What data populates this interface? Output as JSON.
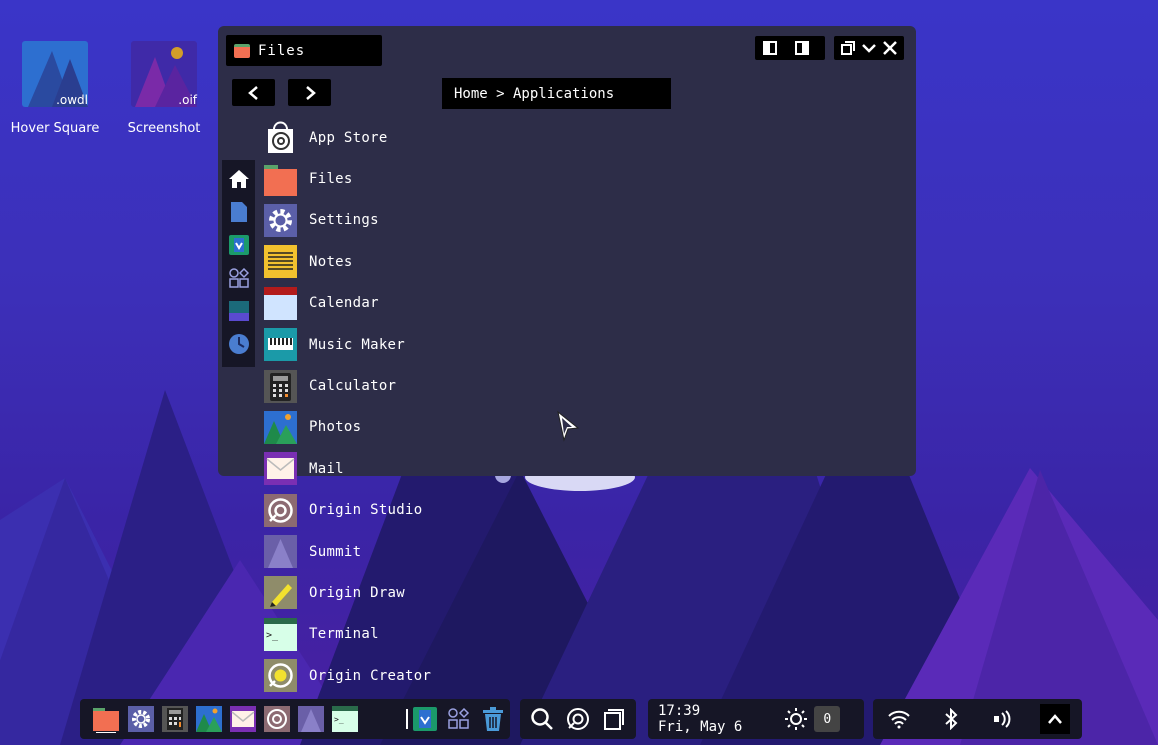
{
  "desktop": {
    "icons": [
      {
        "label": "Hover Square",
        "ext": ".owdl"
      },
      {
        "label": "Screenshot",
        "ext": ".oif"
      }
    ]
  },
  "window": {
    "title": "Files",
    "breadcrumb": "Home > Applications",
    "apps": [
      {
        "name": "App Store",
        "icon": "app-store-icon",
        "color": "#f2f2f2"
      },
      {
        "name": "Files",
        "icon": "folder-icon",
        "color": "#f26f52"
      },
      {
        "name": "Settings",
        "icon": "gear-icon",
        "color": "#5b5fa8"
      },
      {
        "name": "Notes",
        "icon": "notes-icon",
        "color": "#f2c12e"
      },
      {
        "name": "Calendar",
        "icon": "calendar-icon",
        "color": "#d0e4ff"
      },
      {
        "name": "Music Maker",
        "icon": "keyboard-icon",
        "color": "#1b9aa8"
      },
      {
        "name": "Calculator",
        "icon": "calculator-icon",
        "color": "#666666"
      },
      {
        "name": "Photos",
        "icon": "photos-icon",
        "color": "#2d6fd0"
      },
      {
        "name": "Mail",
        "icon": "mail-icon",
        "color": "#7a2fb3"
      },
      {
        "name": "Origin Studio",
        "icon": "studio-icon",
        "color": "#8c6a72"
      },
      {
        "name": "Summit",
        "icon": "summit-icon",
        "color": "#6a5fa8"
      },
      {
        "name": "Origin Draw",
        "icon": "pencil-icon",
        "color": "#8f8c6a"
      },
      {
        "name": "Terminal",
        "icon": "terminal-icon",
        "color": "#d7ffe8"
      },
      {
        "name": "Origin Creator",
        "icon": "creator-icon",
        "color": "#8f8c6a"
      }
    ]
  },
  "taskbar": {
    "time": "17:39",
    "date": "Fri, May 6",
    "notification_count": "0"
  },
  "colors": {
    "window_bg": "#2d2d48",
    "bar_bg": "#161626",
    "accent": "#f26f52"
  }
}
